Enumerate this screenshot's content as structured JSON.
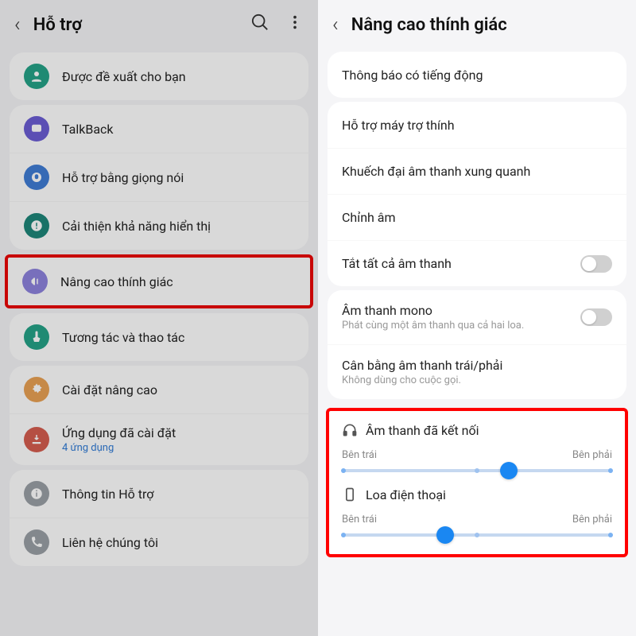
{
  "left": {
    "title": "Hỗ trợ",
    "groups": [
      {
        "items": [
          {
            "icon": "recommend-icon",
            "color": "c-teal",
            "label": "Được đề xuất cho bạn"
          }
        ]
      },
      {
        "items": [
          {
            "icon": "talkback-icon",
            "color": "c-purple",
            "label": "TalkBack"
          },
          {
            "icon": "voice-icon",
            "color": "c-blue",
            "label": "Hỗ trợ bằng giọng nói"
          },
          {
            "icon": "display-icon",
            "color": "c-tealD",
            "label": "Cải thiện khả năng hiển thị"
          }
        ]
      },
      {
        "highlight": true,
        "items": [
          {
            "icon": "hearing-icon",
            "color": "c-lav",
            "label": "Nâng cao thính giác"
          }
        ]
      },
      {
        "items": [
          {
            "icon": "touch-icon",
            "color": "c-tealL",
            "label": "Tương tác và thao tác"
          }
        ]
      },
      {
        "items": [
          {
            "icon": "gear-icon",
            "color": "c-orange",
            "label": "Cài đặt nâng cao"
          },
          {
            "icon": "download-icon",
            "color": "c-red",
            "label": "Ứng dụng đã cài đặt",
            "sub": "4 ứng dụng"
          }
        ]
      },
      {
        "items": [
          {
            "icon": "info-icon",
            "color": "c-grey",
            "label": "Thông tin Hỗ trợ"
          },
          {
            "icon": "phone-icon",
            "color": "c-grey",
            "label": "Liên hệ chúng tôi"
          }
        ]
      }
    ]
  },
  "right": {
    "title": "Nâng cao thính giác",
    "groups": [
      {
        "items": [
          {
            "label": "Thông báo có tiếng động"
          }
        ]
      },
      {
        "items": [
          {
            "label": "Hỗ trợ máy trợ thính"
          },
          {
            "label": "Khuếch đại âm thanh xung quanh"
          },
          {
            "label": "Chỉnh âm"
          },
          {
            "label": "Tắt tất cả âm thanh",
            "toggle": true
          }
        ]
      },
      {
        "items": [
          {
            "label": "Âm thanh mono",
            "sub": "Phát cùng một âm thanh qua cả hai loa.",
            "toggle": true
          },
          {
            "label": "Cân bằng âm thanh trái/phải",
            "sub": "Không dùng cho cuộc gọi."
          }
        ]
      }
    ],
    "sliders": {
      "left_label": "Bên trái",
      "right_label": "Bên phải",
      "groups": [
        {
          "icon": "headphones-icon",
          "title": "Âm thanh đã kết nối",
          "value": 62
        },
        {
          "icon": "phone-outline-icon",
          "title": "Loa điện thoại",
          "value": 38
        }
      ]
    }
  }
}
